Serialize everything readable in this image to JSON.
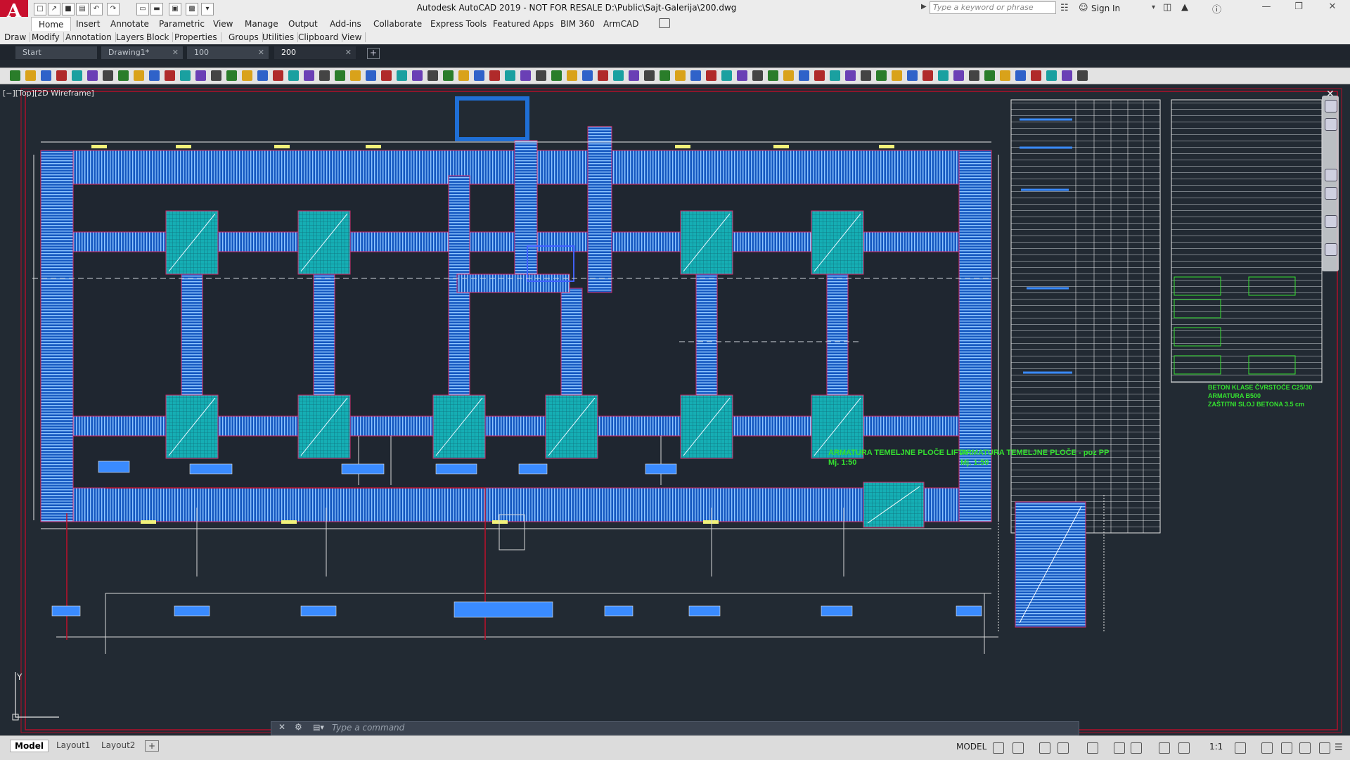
{
  "window": {
    "title": "Autodesk AutoCAD 2019 - NOT FOR RESALE    D:\\Public\\Sajt-Galerija\\200.dwg",
    "search_placeholder": "Type a keyword or phrase",
    "sign_in": "Sign In",
    "logo": "A"
  },
  "ribbon": {
    "tabs": [
      "Home",
      "Insert",
      "Annotate",
      "Parametric",
      "View",
      "Manage",
      "Output",
      "Add-ins",
      "Collaborate",
      "Express Tools",
      "Featured Apps",
      "BIM 360",
      "ArmCAD"
    ],
    "panels": [
      "Draw",
      "Modify",
      "Annotation",
      "Layers",
      "Block",
      "Properties",
      "Groups",
      "Utilities",
      "Clipboard",
      "View"
    ]
  },
  "file_tabs": [
    {
      "label": "Start",
      "closable": false
    },
    {
      "label": "Drawing1*",
      "closable": true
    },
    {
      "label": "100",
      "closable": true
    },
    {
      "label": "200",
      "closable": true,
      "active": true
    }
  ],
  "viewport": {
    "label": "[−][Top][2D Wireframe]"
  },
  "drawing": {
    "titles": [
      "ARMATURA TEMELJNE PLOČE LIFTA",
      "Mj. 1:50",
      "ARMATURA TEMELJNE PLOČE - poz PP",
      "Mj. 1:50"
    ],
    "notes": [
      "BETON KLASE ČVRSTOĆE C25/30",
      "ARMATURA B500",
      "ZAŠTITNI SLOJ BETONA 3.5 cm"
    ]
  },
  "command_line": {
    "placeholder": "Type a command"
  },
  "layout_tabs": [
    "Model",
    "Layout1",
    "Layout2"
  ],
  "status": {
    "mode": "MODEL",
    "scale": "1:1"
  },
  "colors": {
    "background": "#222a33",
    "rebar_blue": "#1f6fd6",
    "footing_cyan": "#17b3b8",
    "annotation_green": "#35e030",
    "outline_red": "#c0102a",
    "autocad_red": "#c8102e"
  }
}
